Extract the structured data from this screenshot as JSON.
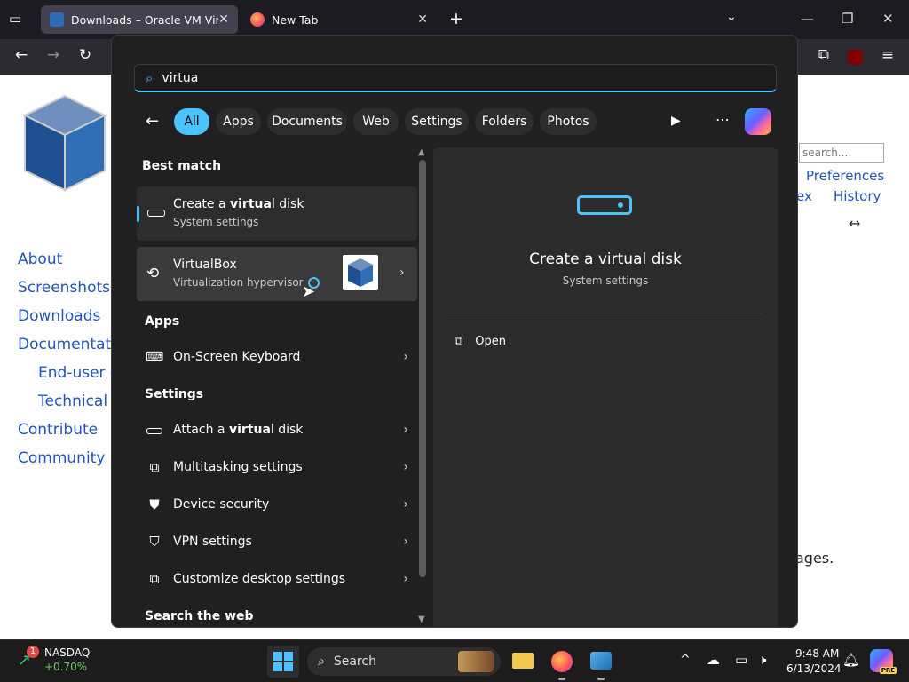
{
  "browser": {
    "tabs": [
      {
        "title": "Downloads – Oracle VM VirtualBox"
      },
      {
        "title": "New Tab"
      }
    ]
  },
  "website": {
    "sidebar_links": [
      "About",
      "Screenshots",
      "Downloads",
      "Documentation",
      "End-user docs",
      "Technical docs",
      "Contribute",
      "Community"
    ],
    "search_placeholder": "search...",
    "top_links": [
      "Preferences",
      "ex",
      "History"
    ],
    "body_fragment": "ages."
  },
  "start_search": {
    "query": "virtua",
    "filters": [
      "All",
      "Apps",
      "Documents",
      "Web",
      "Settings",
      "Folders",
      "Photos"
    ],
    "sections": {
      "best_match": "Best match",
      "apps": "Apps",
      "settings": "Settings",
      "search_web": "Search the web"
    },
    "best_match": {
      "title_pre": "Create a ",
      "title_bold": "virtua",
      "title_post": "l disk",
      "subtitle": "System settings"
    },
    "virtualbox": {
      "title": "VirtualBox",
      "subtitle": "Virtualization hypervisor"
    },
    "apps": [
      {
        "label": "On-Screen Keyboard",
        "icon": "keyboard-icon"
      }
    ],
    "settings": [
      {
        "pre": "Attach a ",
        "bold": "virtua",
        "post": "l disk",
        "icon": "disk-icon"
      },
      {
        "pre": "Multitasking settings",
        "bold": "",
        "post": "",
        "icon": "multitask-icon"
      },
      {
        "pre": "Device security",
        "bold": "",
        "post": "",
        "icon": "shield-icon"
      },
      {
        "pre": "VPN settings",
        "bold": "",
        "post": "",
        "icon": "vpn-shield-icon"
      },
      {
        "pre": "Customize desktop settings",
        "bold": "",
        "post": "",
        "icon": "desktop-icon"
      }
    ],
    "detail": {
      "title": "Create a virtual disk",
      "subtitle": "System settings",
      "action": "Open"
    }
  },
  "taskbar": {
    "widget_title": "NASDAQ",
    "widget_value": "+0.70%",
    "widget_badge": "1",
    "search_label": "Search",
    "time": "9:48 AM",
    "date": "6/13/2024",
    "copilot_badge": "PRE"
  },
  "colors": {
    "accent": "#4cc2ff",
    "panel": "#202020",
    "link": "#2255bb"
  }
}
